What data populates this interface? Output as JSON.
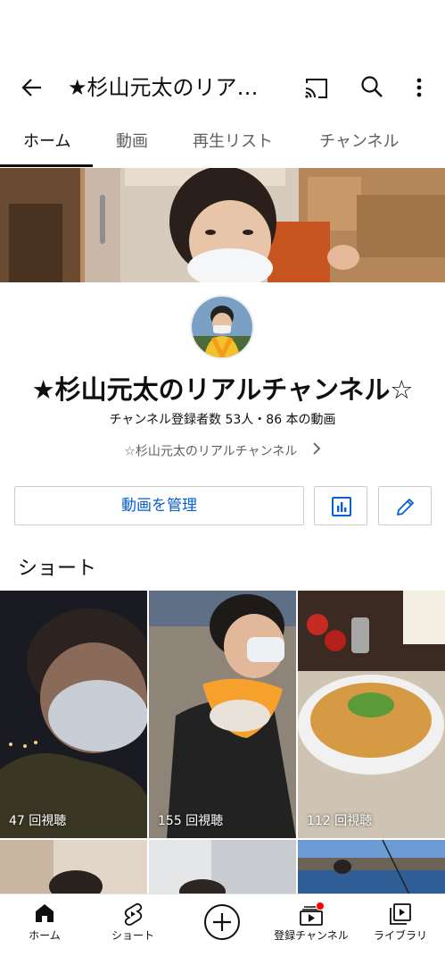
{
  "header": {
    "title": "★杉山元太のリア…",
    "icons": [
      "back-arrow-icon",
      "cast-icon",
      "search-icon",
      "more-vert-icon"
    ]
  },
  "tabs": [
    {
      "label": "ホーム",
      "active": true
    },
    {
      "label": "動画",
      "active": false
    },
    {
      "label": "再生リスト",
      "active": false
    },
    {
      "label": "チャンネル",
      "active": false
    }
  ],
  "channel": {
    "name": "★杉山元太のリアルチャンネル☆",
    "stats": "チャンネル登録者数 53人・86 本の動画",
    "link_text": "☆杉山元太のリアルチャンネル"
  },
  "actions": {
    "manage_label": "動画を管理",
    "icons": [
      "analytics-icon",
      "edit-pencil-icon"
    ]
  },
  "shorts": {
    "section_title": "ショート",
    "items": [
      {
        "views": "47 回視聴"
      },
      {
        "views": "155 回視聴"
      },
      {
        "views": "112 回視聴"
      }
    ]
  },
  "bottom_nav": [
    {
      "label": "ホーム",
      "icon": "home-icon"
    },
    {
      "label": "ショート",
      "icon": "shorts-icon"
    },
    {
      "label": "",
      "icon": "create-plus-icon"
    },
    {
      "label": "登録チャンネル",
      "icon": "subscriptions-icon"
    },
    {
      "label": "ライブラリ",
      "icon": "library-icon"
    }
  ],
  "colors": {
    "link_blue": "#065fd4",
    "notification_red": "#ff0000",
    "text_primary": "#0f0f0f",
    "text_secondary": "#606060"
  }
}
